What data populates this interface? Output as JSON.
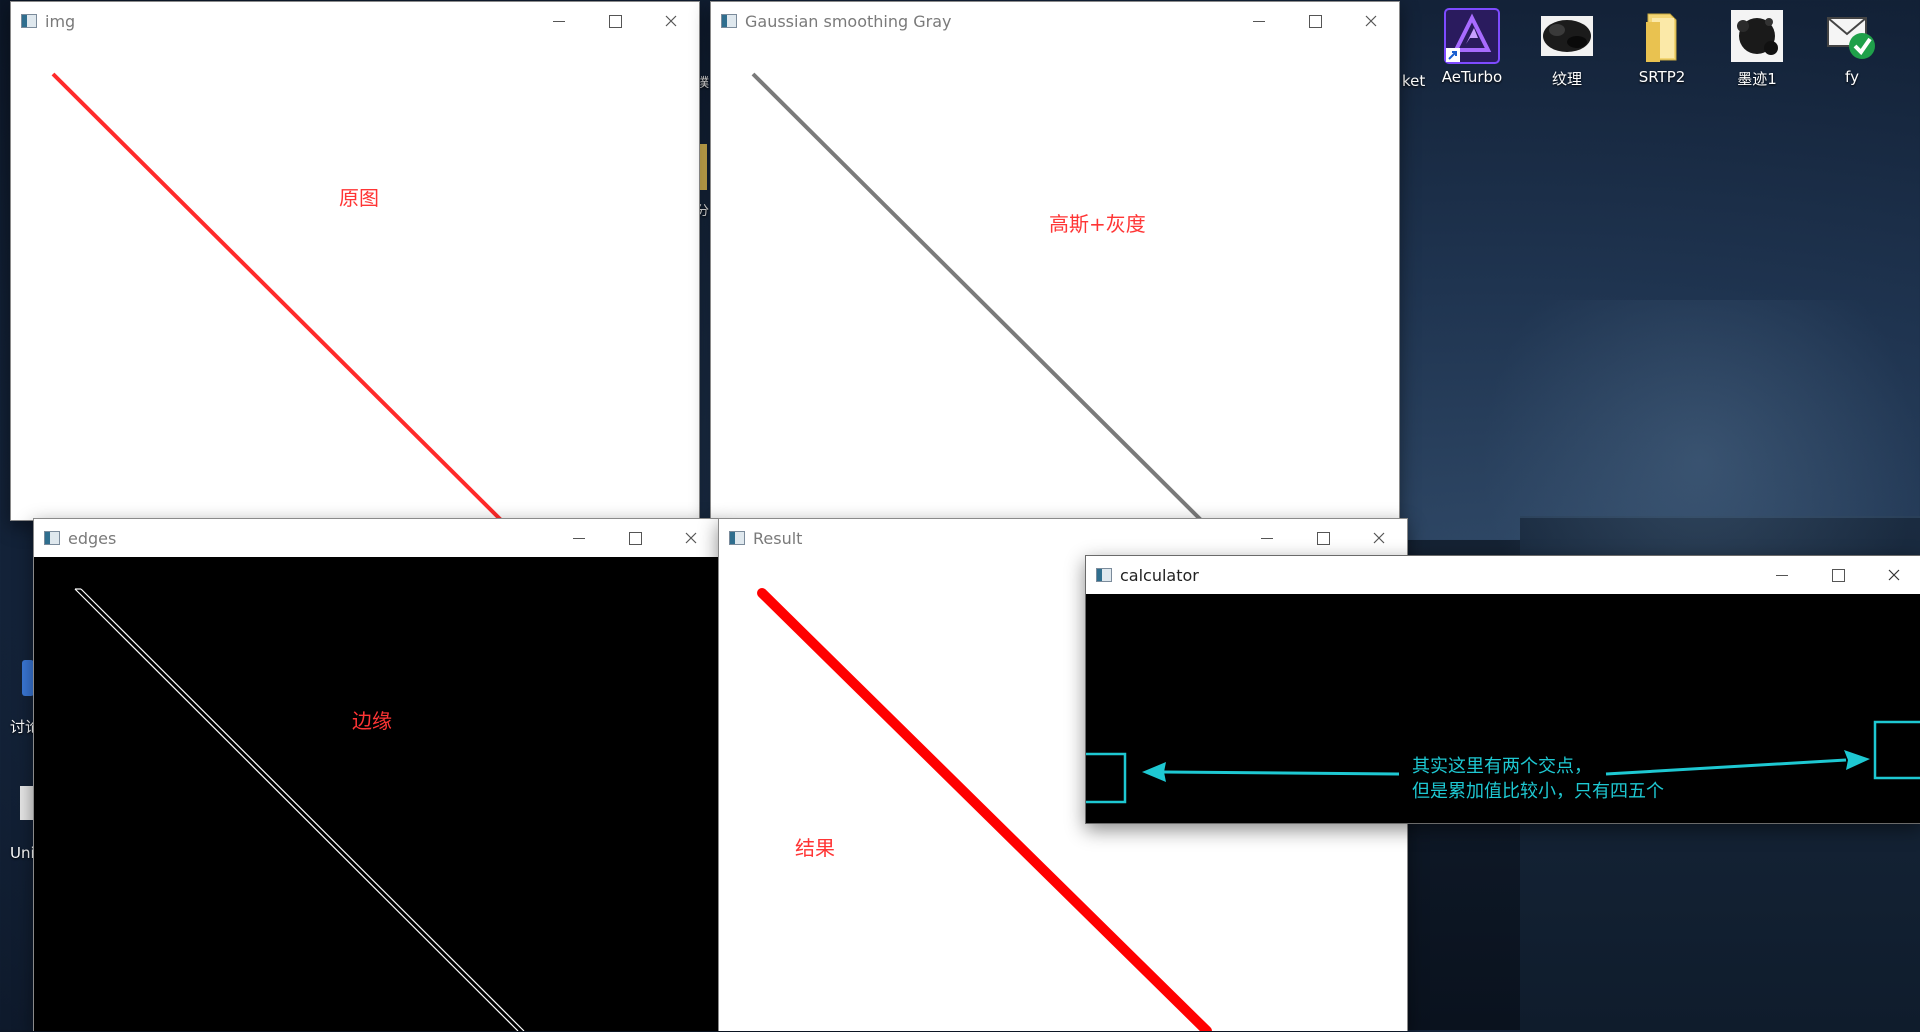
{
  "desktop": {
    "icons": [
      {
        "label": "AeTurbo",
        "icon": "aeturbo-app-icon"
      },
      {
        "label": "纹理",
        "icon": "ink-texture-icon"
      },
      {
        "label": "SRTP2",
        "icon": "folder-icon"
      },
      {
        "label": "墨迹1",
        "icon": "ink-splash-icon"
      },
      {
        "label": "fy",
        "icon": "mail-check-icon"
      }
    ],
    "partial_labels": [
      "ket",
      "撲",
      "分",
      "讨论",
      "Uni"
    ]
  },
  "windows": {
    "img": {
      "title": "img",
      "annotation": "原图",
      "line_color": "#ff2a2a"
    },
    "gaussian": {
      "title": "Gaussian smoothing Gray",
      "annotation": "高斯+灰度",
      "line_color": "#7a7a7a"
    },
    "edges": {
      "title": "edges",
      "annotation": "边缘",
      "line_color": "#ffffff"
    },
    "result": {
      "title": "Result",
      "annotation": "结果",
      "line_color": "#ff0000"
    },
    "calculator": {
      "title": "calculator",
      "note_line1": "其实这里有两个交点，",
      "note_line2": "但是累加值比较小，只有四五个",
      "note_color": "#1ec8d2"
    }
  },
  "colors": {
    "accent_cyan": "#1ec8d2",
    "annotation_red": "#ff3535"
  }
}
